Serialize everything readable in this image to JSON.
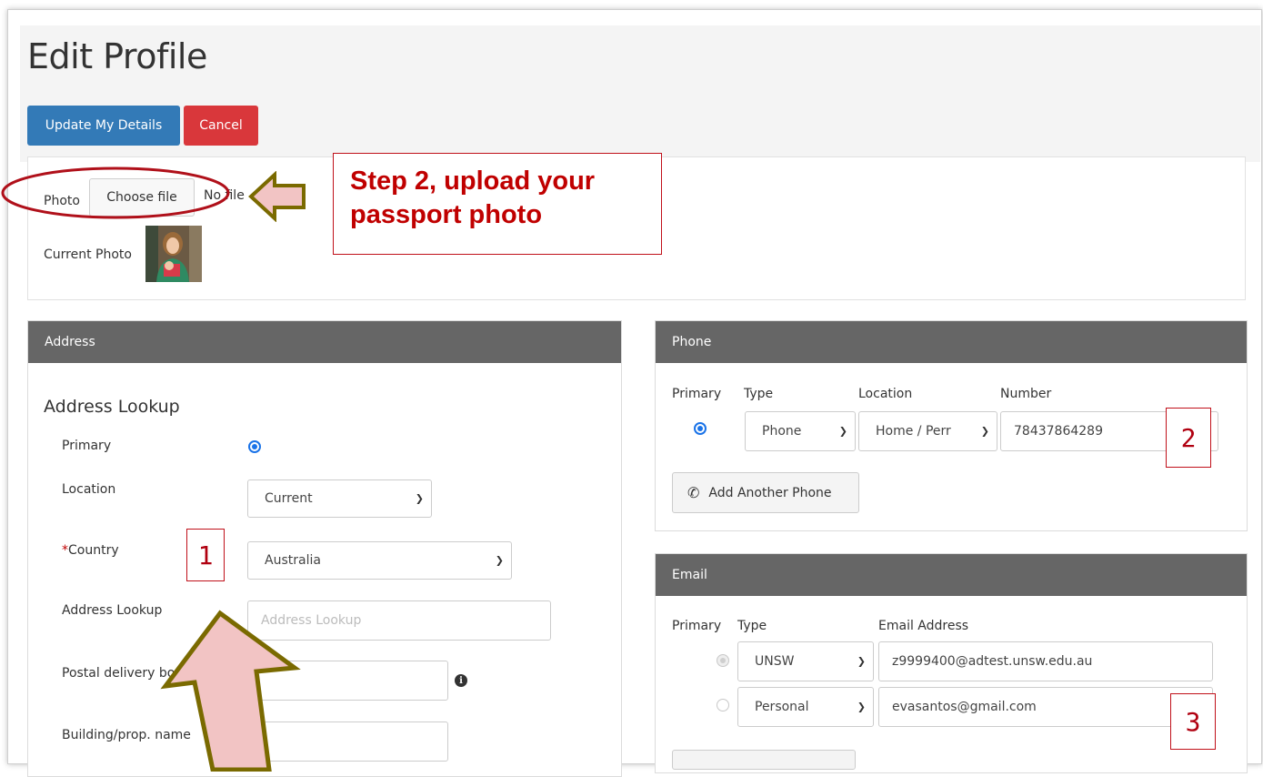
{
  "page": {
    "title": "Edit Profile",
    "update_button": "Update My Details",
    "cancel_button": "Cancel"
  },
  "photo": {
    "label": "Photo",
    "choose_file": "Choose file",
    "no_file": "No file",
    "current_photo_label": "Current Photo"
  },
  "annotations": {
    "step2": "Step 2, upload your passport photo",
    "box1": "1",
    "box2": "2",
    "box3": "3"
  },
  "address": {
    "header": "Address",
    "subtitle": "Address Lookup",
    "primary_label": "Primary",
    "location_label": "Location",
    "location_value": "Current",
    "country_label": "Country",
    "country_required": "*",
    "country_value": "Australia",
    "lookup_label": "Address Lookup",
    "lookup_placeholder": "Address Lookup",
    "postal_label": "Postal delivery box",
    "building_label": "Building/prop. name"
  },
  "phone": {
    "header": "Phone",
    "col_primary": "Primary",
    "col_type": "Type",
    "col_location": "Location",
    "col_number": "Number",
    "type_value": "Phone",
    "location_value": "Home / Perr",
    "number_value": "78437864289",
    "add_button": "Add Another Phone"
  },
  "email": {
    "header": "Email",
    "col_primary": "Primary",
    "col_type": "Type",
    "col_address": "Email Address",
    "rows": [
      {
        "type": "UNSW",
        "address": "z9999400@adtest.unsw.edu.au"
      },
      {
        "type": "Personal",
        "address": "evasantos@gmail.com"
      }
    ]
  },
  "colors": {
    "primary_blue": "#337ab7",
    "cancel_red": "#d9373b",
    "panel_header": "#666666",
    "annotation_red": "#c00000",
    "arrow_fill": "#f2c4c4",
    "arrow_stroke": "#7a6a00"
  }
}
